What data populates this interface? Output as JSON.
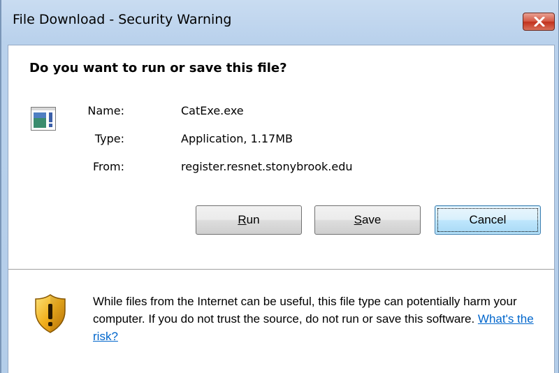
{
  "window": {
    "title": "File Download - Security Warning",
    "close_icon": "close-icon"
  },
  "prompt": {
    "question": "Do you want to run or save this file?"
  },
  "file": {
    "icon": "application-file-icon",
    "name_label": "Name:",
    "name_value": "CatExe.exe",
    "type_label": "Type:",
    "type_value": "Application, 1.17MB",
    "from_label": "From:",
    "from_value": "register.resnet.stonybrook.edu"
  },
  "buttons": {
    "run": {
      "accel": "R",
      "rest": "un"
    },
    "save": {
      "accel": "S",
      "rest": "ave"
    },
    "cancel": {
      "label": "Cancel"
    }
  },
  "warning": {
    "icon": "shield-warning-icon",
    "text": "While files from the Internet can be useful, this file type can potentially harm your computer. If you do not trust the source, do not run or save this software. ",
    "link": "What's the risk?"
  },
  "colors": {
    "titlebar": "#b9d1ec",
    "close_button": "#c2311c",
    "default_button": "#bee6fd",
    "link": "#0066cc",
    "shield": "#e8a317"
  }
}
